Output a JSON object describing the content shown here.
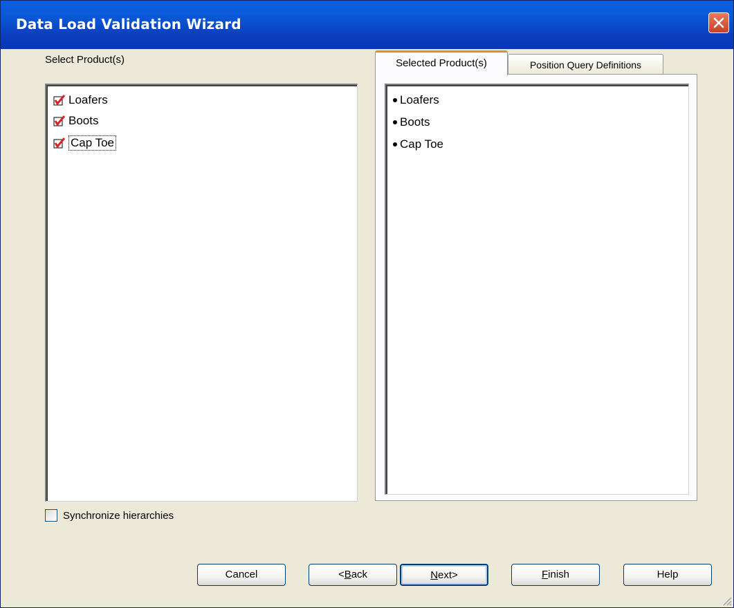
{
  "window": {
    "title": "Data Load Validation Wizard"
  },
  "left_panel": {
    "label": "Select Product(s)",
    "items": [
      {
        "label": "Loafers",
        "checked": true
      },
      {
        "label": "Boots",
        "checked": true
      },
      {
        "label": "Cap Toe",
        "checked": true,
        "focused": true
      }
    ]
  },
  "tabs": [
    {
      "label": "Selected Product(s)",
      "active": true
    },
    {
      "label": "Position Query Definitions",
      "active": false
    }
  ],
  "selected_list": [
    "Loafers",
    "Boots",
    "Cap Toe"
  ],
  "sync_checkbox": {
    "label": "Synchronize hierarchies",
    "checked": false
  },
  "buttons": {
    "cancel": "Cancel",
    "back_prefix": "<",
    "back_mnemonic": "B",
    "back_rest": "ack",
    "next_mnemonic": "N",
    "next_rest": "ext>",
    "finish_mnemonic": "F",
    "finish_rest": "inish",
    "help": "Help"
  },
  "colors": {
    "check_mark": "#d8232a",
    "tab_accent": "#e68b2c",
    "title_bar": "#0a5ad9"
  },
  "icons": {
    "check": "check-mark-icon",
    "close": "close-icon",
    "bullet": "bullet-icon",
    "grip": "resize-grip-icon"
  }
}
